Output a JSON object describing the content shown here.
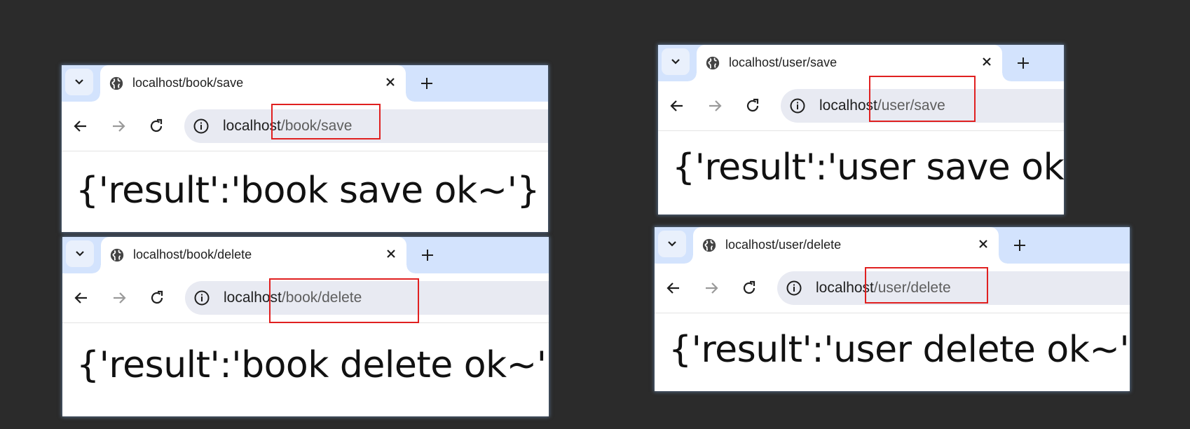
{
  "windows": [
    {
      "tab_title": "localhost/book/save",
      "url_host": "localhost",
      "url_path": "/book/save",
      "result": "{'result':'book save ok~'}"
    },
    {
      "tab_title": "localhost/book/delete",
      "url_host": "localhost",
      "url_path": "/book/delete",
      "result": "{'result':'book delete ok~'}"
    },
    {
      "tab_title": "localhost/user/save",
      "url_host": "localhost",
      "url_path": "/user/save",
      "result": "{'result':'user save ok~'}"
    },
    {
      "tab_title": "localhost/user/delete",
      "url_host": "localhost",
      "url_path": "/user/delete",
      "result": "{'result':'user delete ok~'}"
    }
  ],
  "icons": {
    "tab_menu": "chevron-down-icon",
    "site": "globe-icon",
    "close": "close-icon",
    "new_tab": "plus-icon",
    "back": "back-arrow-icon",
    "forward": "forward-arrow-icon",
    "reload": "reload-icon",
    "site_info": "info-icon"
  },
  "colors": {
    "tabstrip": "#d3e3fd",
    "omnibox": "#e8eaf2",
    "highlight_box": "#e02020",
    "background": "#2b2b2b"
  }
}
